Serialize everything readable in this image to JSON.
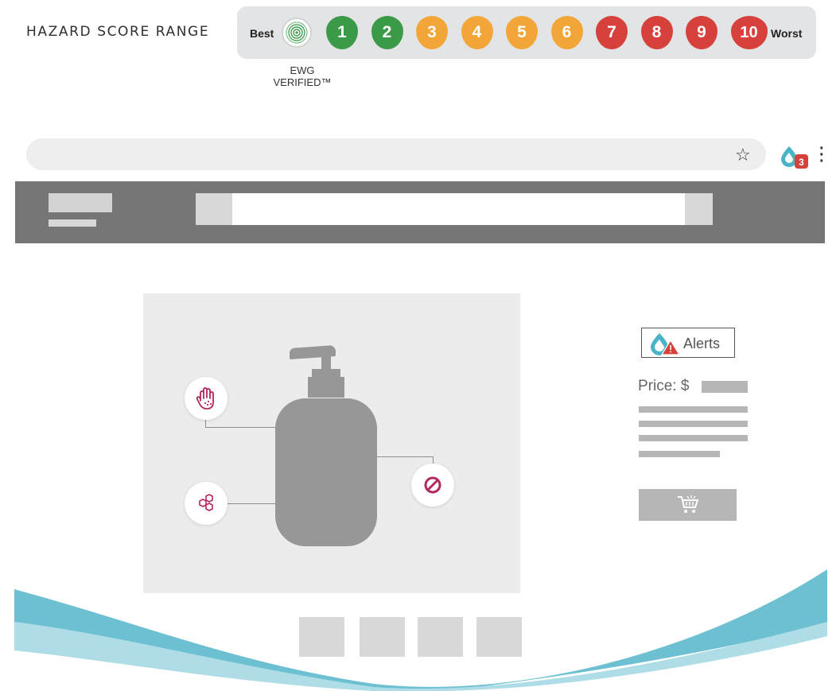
{
  "hazard_legend": {
    "title": "HAZARD SCORE RANGE",
    "best_label": "Best",
    "worst_label": "Worst",
    "verified_label_line1": "EWG",
    "verified_label_line2": "VERIFIED™",
    "scores": [
      {
        "label": "1",
        "color": "#3a9a47"
      },
      {
        "label": "2",
        "color": "#3a9a47"
      },
      {
        "label": "3",
        "color": "#f2a638"
      },
      {
        "label": "4",
        "color": "#f2a638"
      },
      {
        "label": "5",
        "color": "#f2a638"
      },
      {
        "label": "6",
        "color": "#f2a638"
      },
      {
        "label": "7",
        "color": "#d6413b"
      },
      {
        "label": "8",
        "color": "#d6413b"
      },
      {
        "label": "9",
        "color": "#d6413b"
      },
      {
        "label": "10",
        "color": "#d6413b"
      }
    ]
  },
  "browser": {
    "extension_badge_count": "3",
    "icons": {
      "bookmark": "star-icon",
      "extension": "ewg-drop-icon",
      "menu": "kebab-menu-icon"
    }
  },
  "product": {
    "alerts_label": "Alerts",
    "price_label": "Price: $",
    "hazard_icons": [
      "hand-allergy-icon",
      "molecule-icon",
      "prohibited-icon"
    ],
    "cart_icon": "shopping-cart-icon"
  },
  "colors": {
    "accent_magenta": "#b5275f",
    "ewg_teal": "#4ab3c8",
    "alert_red": "#d6413b",
    "wave_dark": "#6cc0d1",
    "wave_light": "#aedde7"
  }
}
